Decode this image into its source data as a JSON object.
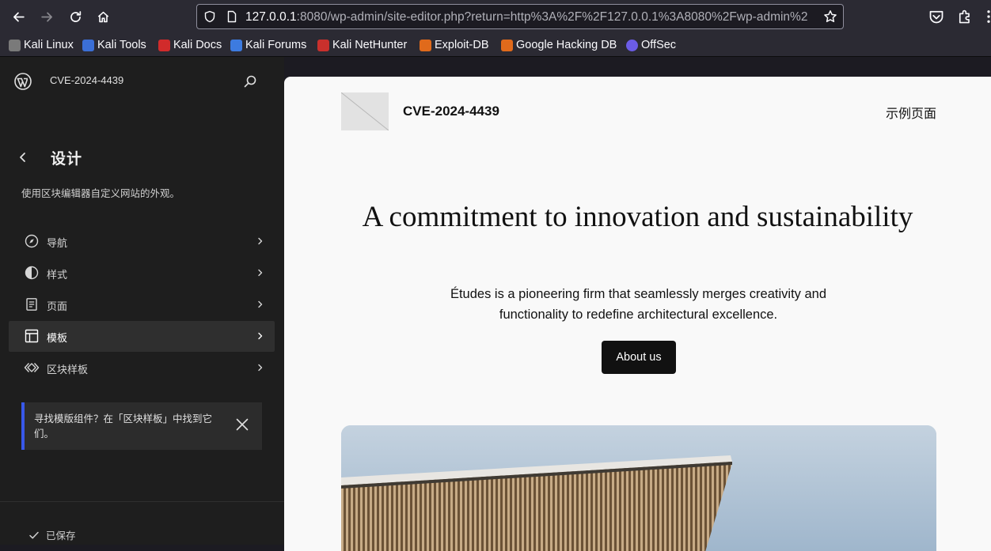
{
  "browser": {
    "url_host": "127.0.0.1",
    "url_rest": ":8080/wp-admin/site-editor.php?return=http%3A%2F%2F127.0.0.1%3A8080%2Fwp-admin%2",
    "bookmarks": [
      {
        "label": "Kali Linux",
        "color": "#7a7a7a"
      },
      {
        "label": "Kali Tools",
        "color": "#3b6fd6"
      },
      {
        "label": "Kali Docs",
        "color": "#d12b2b"
      },
      {
        "label": "Kali Forums",
        "color": "#3d7be0"
      },
      {
        "label": "Kali NetHunter",
        "color": "#c9302c"
      },
      {
        "label": "Exploit-DB",
        "color": "#e06a1b"
      },
      {
        "label": "Google Hacking DB",
        "color": "#e06a1b"
      },
      {
        "label": "OffSec",
        "color": "#6b5ce7"
      }
    ]
  },
  "sidebar": {
    "site_title": "CVE-2024-4439",
    "section_title": "设计",
    "section_desc": "使用区块编辑器自定义网站的外观。",
    "items": [
      {
        "label": "导航",
        "icon": "navigation-icon"
      },
      {
        "label": "样式",
        "icon": "styles-icon"
      },
      {
        "label": "页面",
        "icon": "page-icon"
      },
      {
        "label": "模板",
        "icon": "template-icon",
        "active": true
      },
      {
        "label": "区块样板",
        "icon": "symbol-icon"
      }
    ],
    "notice": "寻找模版组件？在「区块样板」中找到它们。",
    "saved": "已保存"
  },
  "preview": {
    "site_title": "CVE-2024-4439",
    "nav_link": "示例页面",
    "hero_title": "A commitment to innovation and sustainability",
    "hero_text": "Études is a pioneering firm that seamlessly merges creativity and functionality to redefine architectural excellence.",
    "button": "About us"
  },
  "colors": {
    "accent": "#3858e9",
    "sidebar_bg": "#1e1e1e",
    "canvas_bg": "#f9f9f9"
  }
}
